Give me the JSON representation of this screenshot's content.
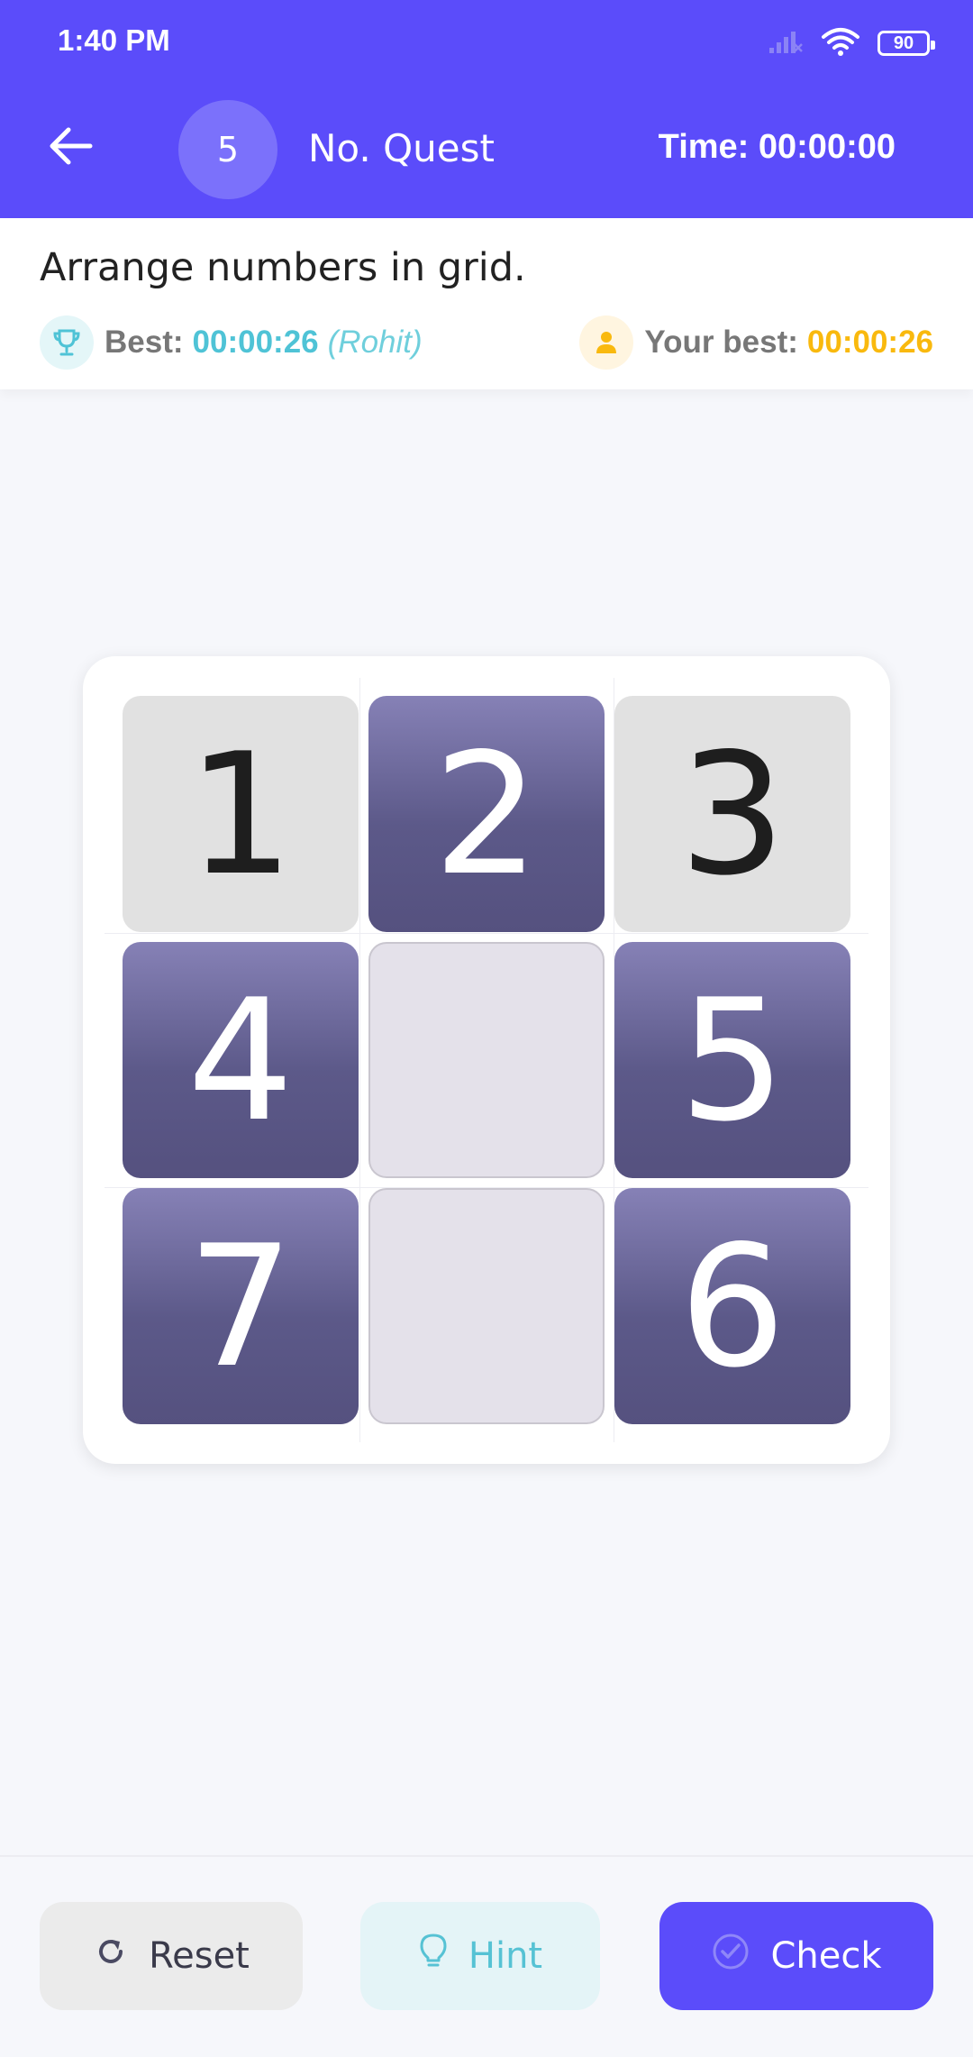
{
  "status_bar": {
    "time": "1:40 PM",
    "battery": "90",
    "icons": [
      "signal-icon",
      "wifi-icon",
      "battery-icon"
    ]
  },
  "header": {
    "level": "5",
    "title": "No. Quest",
    "timer": "Time: 00:00:00",
    "back_icon": "arrow-left-icon"
  },
  "info": {
    "instruction": "Arrange numbers in grid.",
    "best_label": "Best:",
    "best_time": "00:00:26",
    "best_holder": "(Rohit)",
    "your_best_label": "Your best:",
    "your_best_time": "00:00:26"
  },
  "grid": {
    "tiles": [
      {
        "value": "1",
        "kind": "fixed"
      },
      {
        "value": "2",
        "kind": "movable"
      },
      {
        "value": "3",
        "kind": "fixed"
      },
      {
        "value": "4",
        "kind": "movable"
      },
      {
        "value": "",
        "kind": "empty"
      },
      {
        "value": "5",
        "kind": "movable"
      },
      {
        "value": "7",
        "kind": "movable"
      },
      {
        "value": "",
        "kind": "empty"
      },
      {
        "value": "6",
        "kind": "movable"
      }
    ]
  },
  "actions": {
    "reset": "Reset",
    "hint": "Hint",
    "check": "Check"
  },
  "colors": {
    "primary": "#5b4cfa",
    "best_time": "#4fc3d6",
    "your_best_time": "#f9b90e",
    "tile_movable": "#5c5989",
    "tile_fixed": "#e1e1e1"
  }
}
